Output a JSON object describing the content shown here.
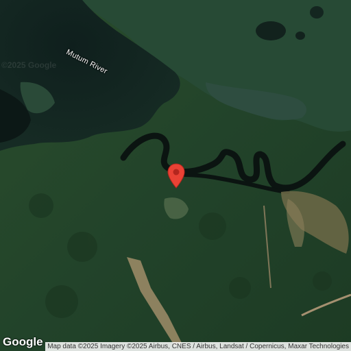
{
  "map": {
    "type": "satellite",
    "watermark": "©2025 Google",
    "labels": {
      "river": "Mutum River"
    },
    "marker": {
      "icon": "map-pin-icon",
      "color": "#e94235"
    },
    "logo": "Google",
    "attribution": "Map data ©2025 Imagery ©2025 Airbus, CNES / Airbus, Landsat / Copernicus, Maxar Technologies"
  }
}
